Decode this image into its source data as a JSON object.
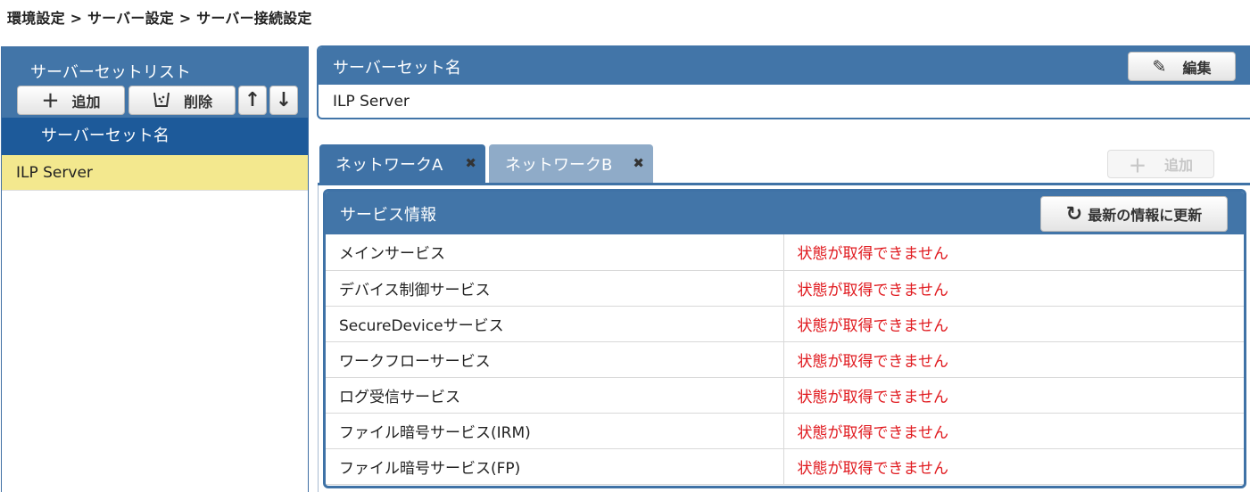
{
  "breadcrumb": "環境設定 > サーバー設定 > サーバー接続設定",
  "server_set_list": {
    "title": "サーバーセットリスト",
    "add_label": "追加",
    "delete_label": "削除",
    "up_icon": "arrow-up-icon",
    "down_icon": "arrow-down-icon",
    "column_header": "サーバーセット名",
    "items": [
      {
        "name": "ILP Server",
        "selected": true
      }
    ]
  },
  "server_set_name": {
    "title": "サーバーセット名",
    "edit_label": "編集",
    "value": "ILP Server"
  },
  "tabs": [
    {
      "label": "ネットワークA",
      "active": true
    },
    {
      "label": "ネットワークB",
      "active": false
    }
  ],
  "tab_add_label": "追加",
  "service_info": {
    "title": "サービス情報",
    "refresh_label": "最新の情報に更新",
    "rows": [
      {
        "name": "メインサービス",
        "status": "状態が取得できません"
      },
      {
        "name": "デバイス制御サービス",
        "status": "状態が取得できません"
      },
      {
        "name": "SecureDeviceサービス",
        "status": "状態が取得できません"
      },
      {
        "name": "ワークフローサービス",
        "status": "状態が取得できません"
      },
      {
        "name": "ログ受信サービス",
        "status": "状態が取得できません"
      },
      {
        "name": "ファイル暗号サービス(IRM)",
        "status": "状態が取得できません"
      },
      {
        "name": "ファイル暗号サービス(FP)",
        "status": "状態が取得できません"
      }
    ]
  },
  "colors": {
    "panel_header": "#4275a8",
    "list_header": "#1d5a9a",
    "selected_row": "#f3e88e",
    "inactive_tab": "#8fabc8",
    "status_error": "#e0191e"
  }
}
